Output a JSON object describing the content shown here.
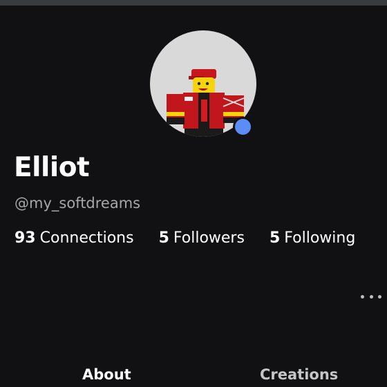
{
  "profile": {
    "display_name": "Elliot",
    "username": "@my_softdreams",
    "presence": "online"
  },
  "stats": [
    {
      "count": "93",
      "label": "Connections"
    },
    {
      "count": "5",
      "label": "Followers"
    },
    {
      "count": "5",
      "label": "Following"
    }
  ],
  "more_menu": {
    "icon": "more-horizontal-icon"
  },
  "tabs": [
    {
      "label": "About",
      "selected": true
    },
    {
      "label": "Creations",
      "selected": false
    }
  ],
  "colors": {
    "background": "#111113",
    "presence_online": "#5c8df6",
    "secondary_text": "#a6a7ab"
  }
}
